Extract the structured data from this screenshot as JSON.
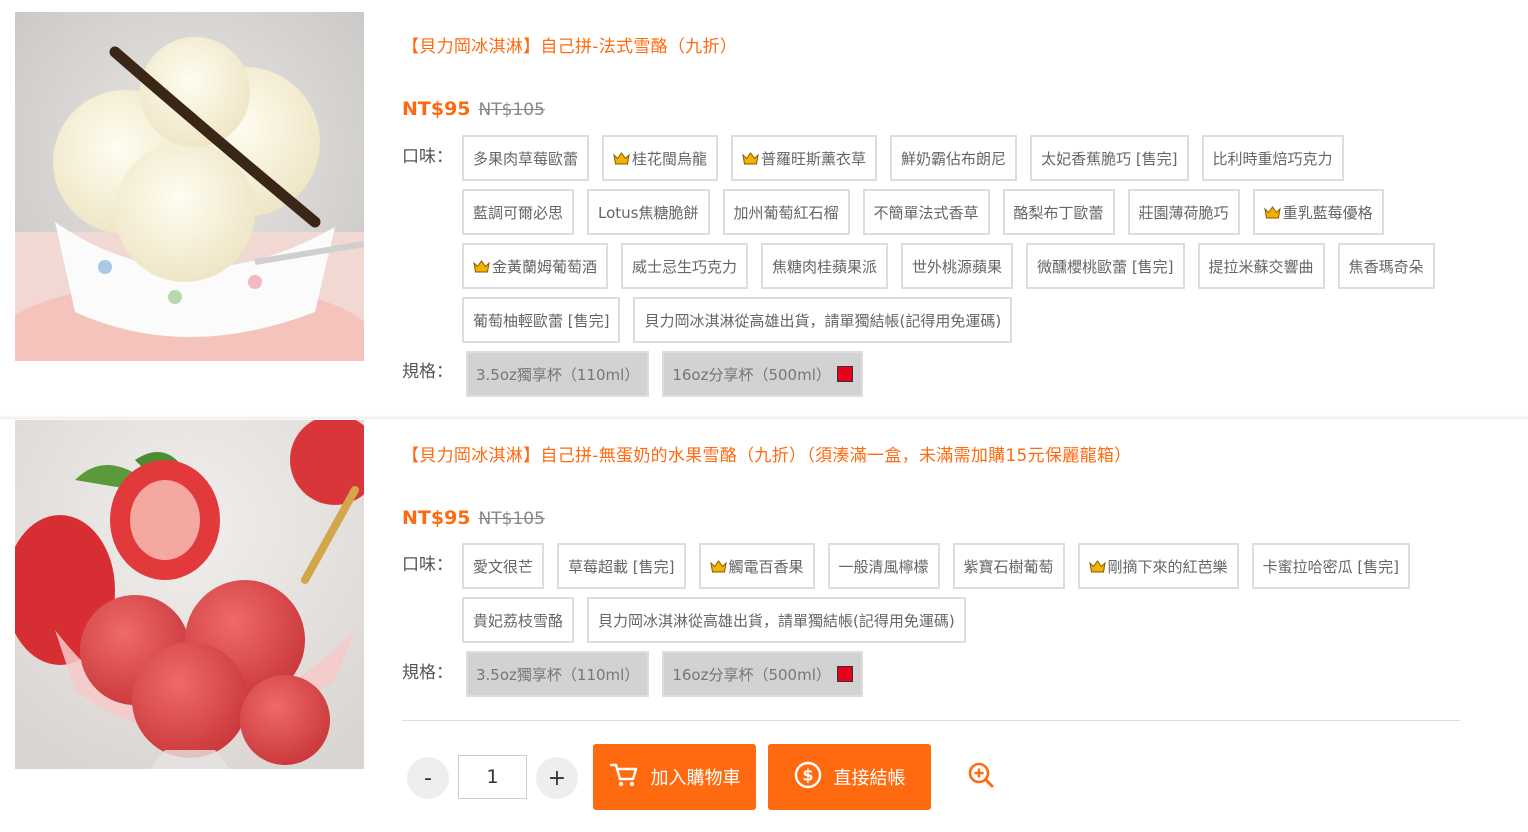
{
  "products": [
    {
      "title": "【貝力岡冰淇淋】自己拼-法式雪酪（九折）",
      "price": "NT$95",
      "old_price": "NT$105",
      "flavor_label": "口味：",
      "spec_label": "規格：",
      "image_alt": "vanilla ice cream",
      "flavors": [
        {
          "label": "多果肉草莓歐蕾",
          "crown": false
        },
        {
          "label": "桂花閩烏龍",
          "crown": true
        },
        {
          "label": "普羅旺斯薰衣草",
          "crown": true
        },
        {
          "label": "鮮奶霸佔布朗尼",
          "crown": false
        },
        {
          "label": "太妃香蕉脆巧 [售完]",
          "crown": false
        },
        {
          "label": "比利時重焙巧克力",
          "crown": false
        },
        {
          "label": "藍調可爾必思",
          "crown": false
        },
        {
          "label": "Lotus焦糖脆餅",
          "crown": false
        },
        {
          "label": "加州葡萄紅石榴",
          "crown": false
        },
        {
          "label": "不簡單法式香草",
          "crown": false
        },
        {
          "label": "酪梨布丁歐蕾",
          "crown": false
        },
        {
          "label": "莊園薄荷脆巧",
          "crown": false
        },
        {
          "label": "重乳藍莓優格",
          "crown": true
        },
        {
          "label": "金黃蘭姆葡萄酒",
          "crown": true
        },
        {
          "label": "威士忌生巧克力",
          "crown": false
        },
        {
          "label": "焦糖肉桂蘋果派",
          "crown": false
        },
        {
          "label": "世外桃源蘋果",
          "crown": false
        },
        {
          "label": "微醺櫻桃歐蕾 [售完]",
          "crown": false
        },
        {
          "label": "提拉米蘇交響曲",
          "crown": false
        },
        {
          "label": "焦香瑪奇朵",
          "crown": false
        },
        {
          "label": "葡萄柚輕歐蕾 [售完]",
          "crown": false
        },
        {
          "label": "貝力岡冰淇淋從高雄出貨，請單獨結帳(記得用免運碼)",
          "crown": false
        }
      ],
      "specs": [
        {
          "label": "3.5oz獨享杯（110ml）",
          "swatch": false
        },
        {
          "label": "16oz分享杯（500ml）",
          "swatch": true
        }
      ]
    },
    {
      "title": "【貝力岡冰淇淋】自己拼-無蛋奶的水果雪酪（九折）（須湊滿一盒，未滿需加購15元保麗龍箱）",
      "price": "NT$95",
      "old_price": "NT$105",
      "flavor_label": "口味：",
      "spec_label": "規格：",
      "image_alt": "strawberry sorbet",
      "flavors": [
        {
          "label": "愛文很芒",
          "crown": false
        },
        {
          "label": "草莓超載 [售完]",
          "crown": false
        },
        {
          "label": "觸電百香果",
          "crown": true
        },
        {
          "label": "一般清風檸檬",
          "crown": false
        },
        {
          "label": "紫寶石樹葡萄",
          "crown": false
        },
        {
          "label": "剛摘下來的紅芭樂",
          "crown": true
        },
        {
          "label": "卡蜜拉哈密瓜 [售完]",
          "crown": false
        },
        {
          "label": "貴妃荔枝雪酪",
          "crown": false
        },
        {
          "label": "貝力岡冰淇淋從高雄出貨，請單獨結帳(記得用免運碼)",
          "crown": false
        }
      ],
      "specs": [
        {
          "label": "3.5oz獨享杯（110ml）",
          "swatch": false
        },
        {
          "label": "16oz分享杯（500ml）",
          "swatch": true
        }
      ]
    }
  ],
  "cart": {
    "minus": "-",
    "plus": "+",
    "quantity": "1",
    "add_to_cart": "加入購物車",
    "checkout": "直接結帳"
  },
  "colors": {
    "accent": "#ff6a10",
    "swatch_red": "#e8001c",
    "crown_gold": "#f2b300"
  }
}
